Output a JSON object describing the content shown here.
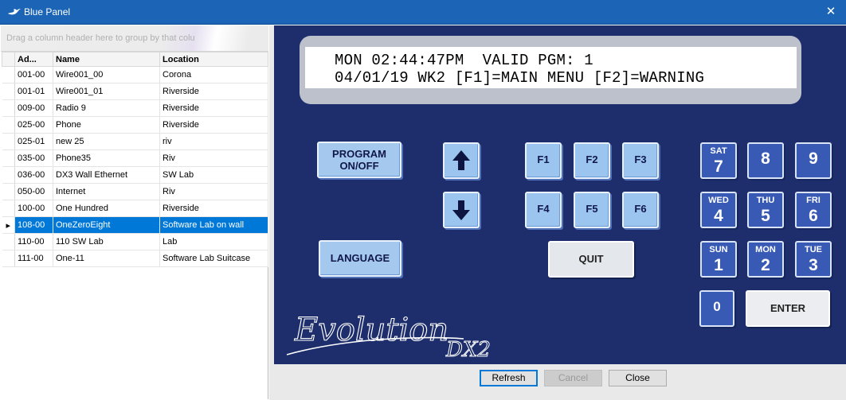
{
  "window": {
    "title": "Blue Panel",
    "close_glyph": "✕"
  },
  "grid": {
    "group_hint": "Drag a column header here to group by that column",
    "columns": [
      "Ad...",
      "Name",
      "Location"
    ],
    "rows": [
      {
        "addr": "001-00",
        "name": "Wire001_00",
        "location": "Corona"
      },
      {
        "addr": "001-01",
        "name": "Wire001_01",
        "location": "Riverside"
      },
      {
        "addr": "009-00",
        "name": "Radio 9",
        "location": "Riverside"
      },
      {
        "addr": "025-00",
        "name": "Phone",
        "location": "Riverside"
      },
      {
        "addr": "025-01",
        "name": "new 25",
        "location": "riv"
      },
      {
        "addr": "035-00",
        "name": "Phone35",
        "location": "Riv"
      },
      {
        "addr": "036-00",
        "name": "DX3 Wall Ethernet",
        "location": "SW Lab"
      },
      {
        "addr": "050-00",
        "name": "Internet",
        "location": "Riv"
      },
      {
        "addr": "100-00",
        "name": "One Hundred",
        "location": "Riverside"
      },
      {
        "addr": "108-00",
        "name": "OneZeroEight",
        "location": "Software Lab on wall"
      },
      {
        "addr": "110-00",
        "name": "110 SW Lab",
        "location": "Lab"
      },
      {
        "addr": "111-00",
        "name": "One-11",
        "location": "Software Lab Suitcase"
      }
    ],
    "selected_index": 9,
    "row_indicator": "▸"
  },
  "lcd": {
    "line1": "MON 02:44:47PM  VALID PGM: 1",
    "line2": "04/01/19 WK2 [F1]=MAIN MENU [F2]=WARNING"
  },
  "keys": {
    "program_line1": "PROGRAM",
    "program_line2": "ON/OFF",
    "language": "LANGUAGE",
    "quit": "QUIT",
    "enter": "ENTER",
    "f1": "F1",
    "f2": "F2",
    "f3": "F3",
    "f4": "F4",
    "f5": "F5",
    "f6": "F6",
    "num7_day": "SAT",
    "num7": "7",
    "num8": "8",
    "num9": "9",
    "num4_day": "WED",
    "num4": "4",
    "num5_day": "THU",
    "num5": "5",
    "num6_day": "FRI",
    "num6": "6",
    "num1_day": "SUN",
    "num1": "1",
    "num2_day": "MON",
    "num2": "2",
    "num3_day": "TUE",
    "num3": "3",
    "num0": "0"
  },
  "logo": {
    "script": "Evolution",
    "model": "DX2"
  },
  "buttons": {
    "refresh": "Refresh",
    "cancel": "Cancel",
    "close": "Close"
  },
  "colors": {
    "titlebar": "#1b64b6",
    "selection": "#0078d7",
    "panel": "#1e2e6c",
    "key_light": "#9bc4ef",
    "key_num": "#385ab5"
  }
}
